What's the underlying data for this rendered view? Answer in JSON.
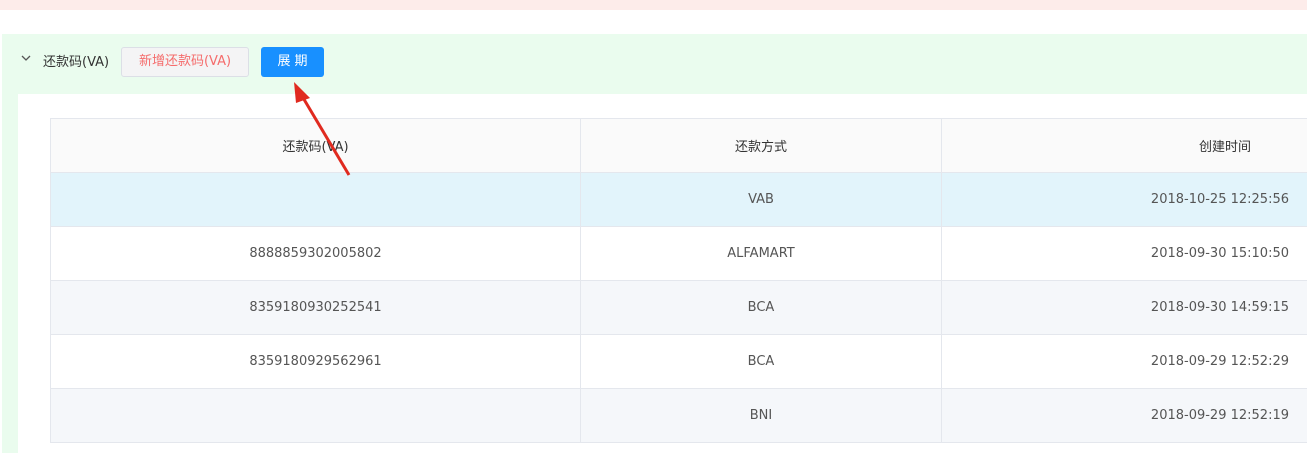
{
  "panel": {
    "title": "还款码(VA)",
    "add_button_label": "新增还款码(VA)",
    "extend_button_label": "展期",
    "chevron_icon": "chevron-down-icon"
  },
  "table": {
    "columns": [
      "还款码(VA)",
      "还款方式",
      "创建时间"
    ],
    "rows": [
      {
        "code": "",
        "method": "VAB",
        "created": "2018-10-25 12:25:56"
      },
      {
        "code": "8888859302005802",
        "method": "ALFAMART",
        "created": "2018-09-30 15:10:50"
      },
      {
        "code": "8359180930252541",
        "method": "BCA",
        "created": "2018-09-30 14:59:15"
      },
      {
        "code": "8359180929562961",
        "method": "BCA",
        "created": "2018-09-29 12:52:29"
      },
      {
        "code": "",
        "method": "BNI",
        "created": "2018-09-29 12:52:19"
      }
    ]
  },
  "annotation": {
    "arrow_color": "#e02a1f",
    "icon": "pointer-arrow-icon"
  },
  "colors": {
    "primary": "#1890ff",
    "danger_text": "#f56c6c",
    "panel_bg": "#eafcee",
    "top_strip": "#fdecea",
    "row_highlight": "#e2f4fb"
  }
}
